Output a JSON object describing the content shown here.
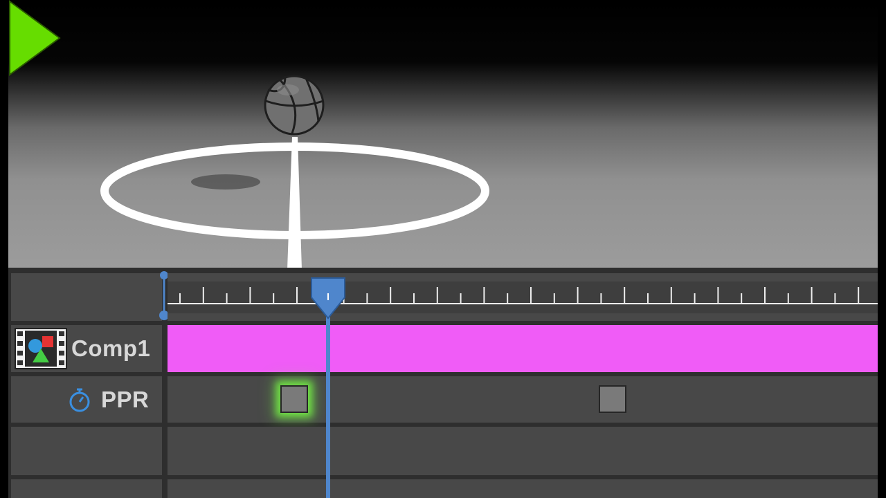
{
  "layers": [
    {
      "name": "Comp1",
      "icon": "composition-icon"
    },
    {
      "name": "PPR",
      "icon": "stopwatch-icon"
    }
  ],
  "icons": {
    "play": "play-icon",
    "playhead": "playhead-marker-icon",
    "keyframe": "keyframe-icon"
  },
  "colors": {
    "play_green": "#66dd00",
    "composition_bar": "#f05cf7",
    "playhead_blue": "#4f86cc",
    "panel_gray": "#484848",
    "keyframe_glow": "#78ff46"
  },
  "keyframes_ppr": [
    {
      "selected": true
    },
    {
      "selected": false
    }
  ],
  "playhead_fraction": 0.226
}
